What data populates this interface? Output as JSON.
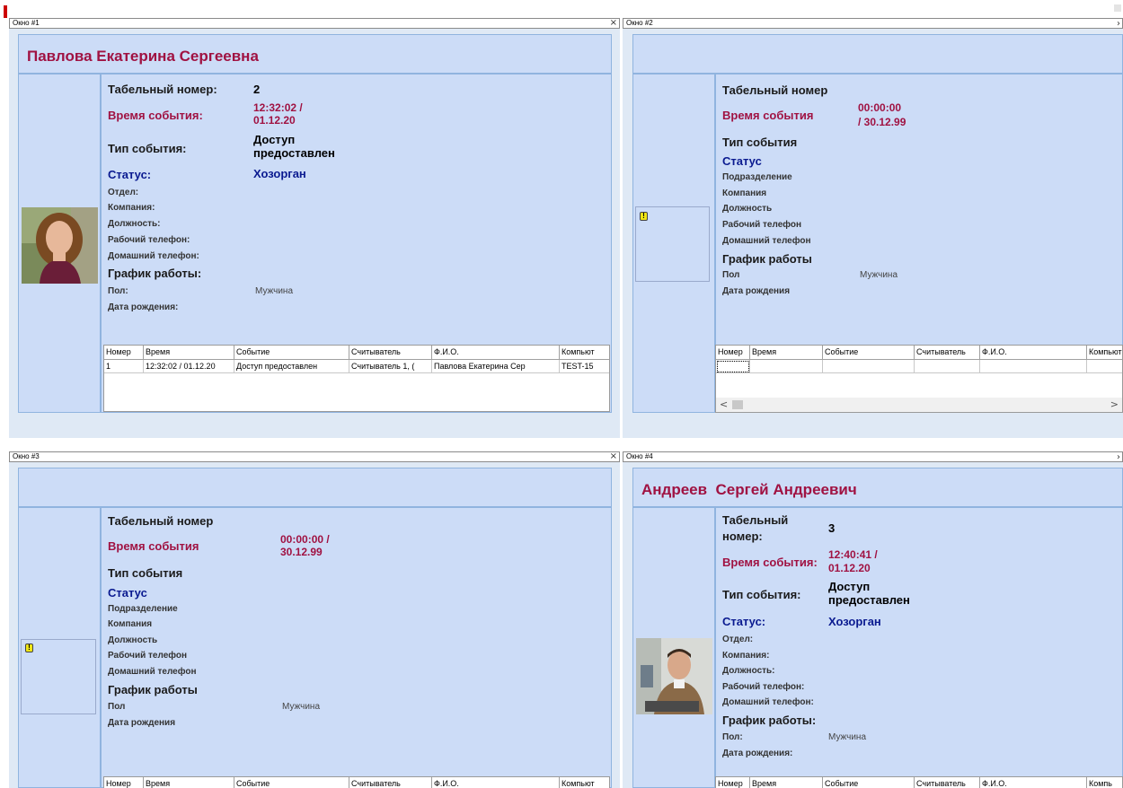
{
  "windows": [
    {
      "title": "Окно #1",
      "close": "×",
      "name": "Павлова Екатерина Сергеевна",
      "labels": {
        "tab": "Табельный номер:",
        "time": "Время события:",
        "event": "Тип события:",
        "status": "Статус:",
        "dept": "Отдел:",
        "company": "Компания:",
        "position": "Должность:",
        "work_phone": "Рабочий телефон:",
        "home_phone": "Домашний телефон:",
        "schedule": "График работы:",
        "gender": "Пол:",
        "birth": "Дата рождения:"
      },
      "values": {
        "tab": "2",
        "time_1": "12:32:02 /",
        "time_2": "01.12.20",
        "event_1": "Доступ",
        "event_2": "предоставлен",
        "status": "Хозорган",
        "gender": "Мужчина"
      },
      "grid": {
        "columns": [
          "Номер",
          "Время",
          "Событие",
          "Считыватель",
          "Ф.И.О.",
          "Компьют"
        ],
        "rows": [
          [
            "1",
            "12:32:02 / 01.12.20",
            "Доступ предоставлен",
            "Считыватель 1, (",
            "Павлова Екатерина Сер",
            "TEST-15"
          ]
        ]
      }
    },
    {
      "title": "Окно #2",
      "labels": {
        "tab": "Табельный номер",
        "time": "Время события",
        "event": "Тип события",
        "status": "Статус",
        "dept": "Подразделение",
        "company": "Компания",
        "position": "Должность",
        "work_phone": "Рабочий телефон",
        "home_phone": "Домашний телефон",
        "schedule": "График работы",
        "gender": "Пол",
        "birth": "Дата рождения"
      },
      "values": {
        "time_1": "00:00:00",
        "time_2": "/ 30.12.99",
        "gender": "Мужчина"
      },
      "warn": "!",
      "grid": {
        "columns": [
          "Номер",
          "Время",
          "Событие",
          "Считыватель",
          "Ф.И.О.",
          "Компьют"
        ]
      },
      "scroll_left": "<",
      "scroll_right": ">"
    },
    {
      "title": "Окно #3",
      "close": "×",
      "labels": {
        "tab": "Табельный номер",
        "time": "Время события",
        "event": "Тип события",
        "status": "Статус",
        "dept": "Подразделение",
        "company": "Компания",
        "position": "Должность",
        "work_phone": "Рабочий телефон",
        "home_phone": "Домашний телефон",
        "schedule": "График работы",
        "gender": "Пол",
        "birth": "Дата рождения"
      },
      "values": {
        "time_1": "00:00:00 /",
        "time_2": "30.12.99",
        "gender": "Мужчина"
      },
      "warn": "!",
      "grid": {
        "columns": [
          "Номер",
          "Время",
          "Событие",
          "Считыватель",
          "Ф.И.О.",
          "Компьют"
        ]
      }
    },
    {
      "title": "Окно #4",
      "name": "Андреев  Сергей Андреевич",
      "labels": {
        "tab_1": "Табельный",
        "tab_2": "номер:",
        "time": "Время события:",
        "event": "Тип события:",
        "status": "Статус:",
        "dept": "Отдел:",
        "company": "Компания:",
        "position": "Должность:",
        "work_phone": "Рабочий телефон:",
        "home_phone": "Домашний телефон:",
        "schedule": "График работы:",
        "gender": "Пол:",
        "birth": "Дата рождения:"
      },
      "values": {
        "tab": "3",
        "time_1": "12:40:41 /",
        "time_2": "01.12.20",
        "event_1": "Доступ",
        "event_2": "предоставлен",
        "status": "Хозорган",
        "gender": "Мужчина"
      },
      "grid": {
        "columns": [
          "Номер",
          "Время",
          "Событие",
          "Считыватель",
          "Ф.И.О.",
          "Компь"
        ]
      }
    }
  ],
  "edge_arrow": "›",
  "colors": {
    "name": "#a01242",
    "status": "#0a1a90",
    "panel": "#ccdcf7",
    "panel_border": "#90b4df",
    "window_bg": "#dfe9f5"
  }
}
